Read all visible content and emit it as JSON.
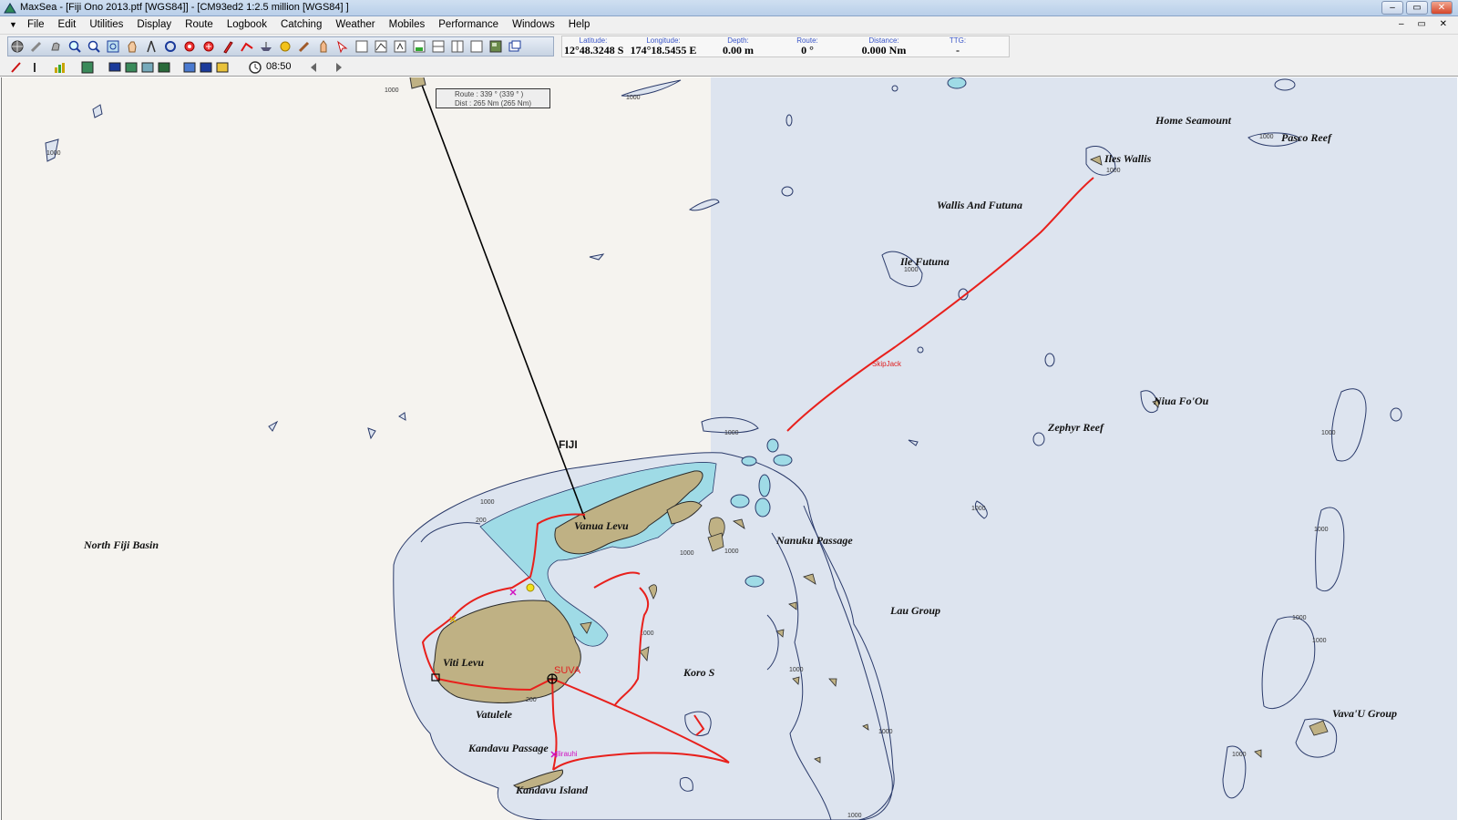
{
  "window": {
    "title": "MaxSea - [Fiji Ono 2013.ptf [WGS84]] - [CM93ed2  1:2.5 million [WGS84] ]",
    "controls": [
      "–",
      "▭",
      "✕"
    ]
  },
  "menubar": {
    "items": [
      "File",
      "Edit",
      "Utilities",
      "Display",
      "Route",
      "Logbook",
      "Catching",
      "Weather",
      "Mobiles",
      "Performance",
      "Windows",
      "Help"
    ],
    "mdi_controls": "– ▭ ✕"
  },
  "toolbar": {
    "icons": [
      "globe-icon",
      "pen-icon",
      "hand-icon",
      "zoom-in-icon",
      "zoom-out-icon",
      "zoom-fit-icon",
      "pan-icon",
      "compass-icon",
      "measure-icon",
      "target-icon",
      "mark-icon",
      "pencil-icon",
      "route-icon",
      "boat-icon",
      "duck-icon",
      "brush-icon",
      "finger-icon",
      "select-icon",
      "graph-icon",
      "panel-icon",
      "text-icon",
      "layout-a-icon",
      "layout-b-icon",
      "layout-c-icon",
      "layout-d-icon",
      "photo-icon",
      "window-icon"
    ]
  },
  "readouts": {
    "latitude": {
      "label": "Latitude:",
      "value": "12°48.3248 S"
    },
    "longitude": {
      "label": "Longitude:",
      "value": "174°18.5455 E"
    },
    "depth": {
      "label": "Depth:",
      "value": "0.00 m"
    },
    "route": {
      "label": "Route:",
      "value": "0 °"
    },
    "distance": {
      "label": "Distance:",
      "value": "0.000 Nm"
    },
    "ttg": {
      "label": "TTG:",
      "value": "-"
    }
  },
  "toolbar2": {
    "time": "08:50"
  },
  "route_tooltip": {
    "line1": "Route : 339 ° (339 ° )",
    "line2": "Dist : 265 Nm (265 Nm)"
  },
  "map": {
    "colors": {
      "land": "#bfb184",
      "shallow": "#9fdbe6",
      "deep_left": "#f5f3ef",
      "deep_right": "#dde4ef",
      "reef": "#dde4ef",
      "track": "#e8201c",
      "route": "#000000"
    },
    "labels": {
      "home_seamount": "Home Seamount",
      "pasco_reef": "Pasco Reef",
      "iles_wallis": "Iles Wallis",
      "wallis_futuna": "Wallis And Futuna",
      "ile_futuna": "Ile Futuna",
      "skipjack": "SkipJack",
      "niua_foou": "Niua Fo'Ou",
      "zephyr_reef": "Zephyr Reef",
      "fiji": "FIJI",
      "vanua_levu": "Vanua Levu",
      "north_fiji_basin": "North Fiji Basin",
      "nanuku_passage": "Nanuku Passage",
      "lau_group": "Lau Group",
      "viti_levu": "Viti Levu",
      "suva": "SUVA",
      "koro": "Koro S",
      "vatulele": "Vatulele",
      "kandavu_passage": "Kandavu Passage",
      "kandavu_island": "Kandavu Island",
      "vavau_group": "Vava'U Group",
      "boat_label": "Ilirauhi"
    },
    "depth_contours": [
      "1000",
      "1000",
      "1000",
      "1000",
      "1000",
      "1000",
      "1000",
      "1000",
      "1000",
      "1000",
      "1000",
      "1000",
      "1000",
      "1000",
      "1000",
      "1000",
      "1000",
      "200",
      "200",
      "1000",
      "1000",
      "1000"
    ]
  }
}
